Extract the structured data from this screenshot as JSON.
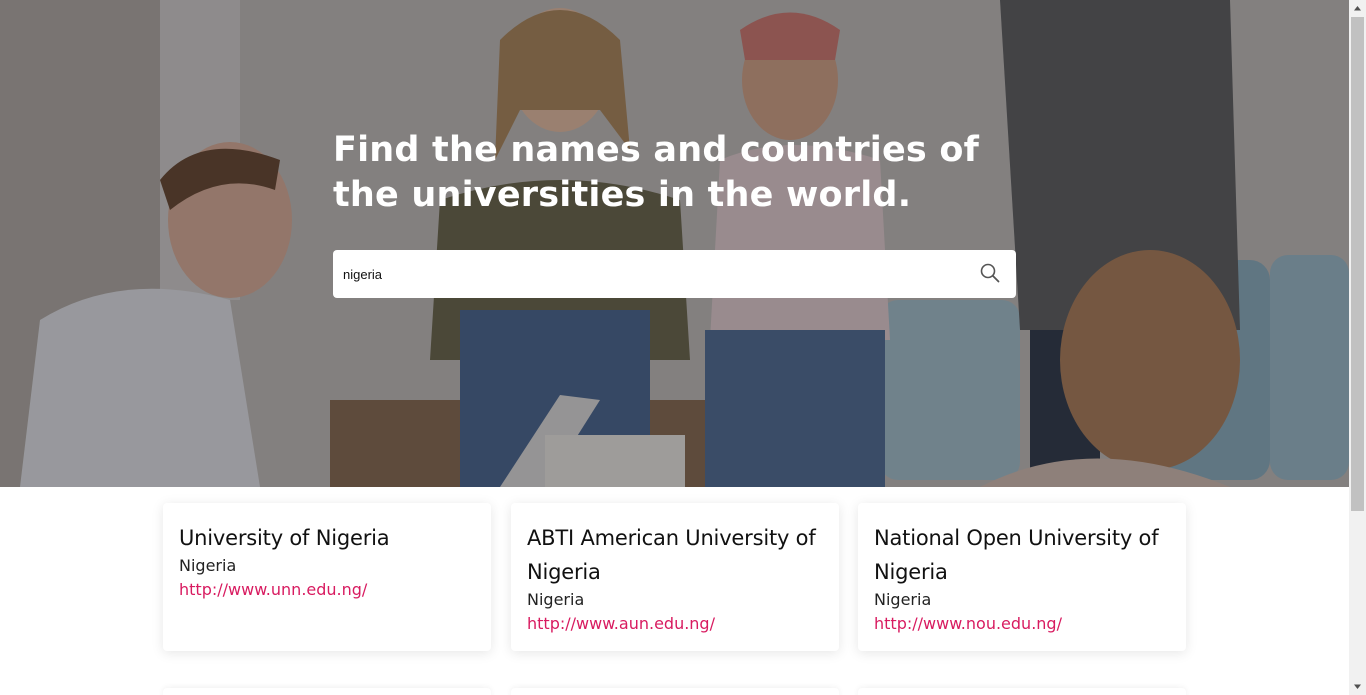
{
  "hero": {
    "title": "Find the names and countries of the universities in the world."
  },
  "search": {
    "value": "nigeria",
    "icon": "search-icon"
  },
  "results": [
    {
      "name": "University of Nigeria",
      "country": "Nigeria",
      "url": "http://www.unn.edu.ng/"
    },
    {
      "name": "ABTI American University of Nigeria",
      "country": "Nigeria",
      "url": "http://www.aun.edu.ng/"
    },
    {
      "name": "National Open University of Nigeria",
      "country": "Nigeria",
      "url": "http://www.nou.edu.ng/"
    }
  ],
  "colors": {
    "link": "#d81b60",
    "card_background": "#ffffff",
    "hero_text": "#ffffff"
  }
}
